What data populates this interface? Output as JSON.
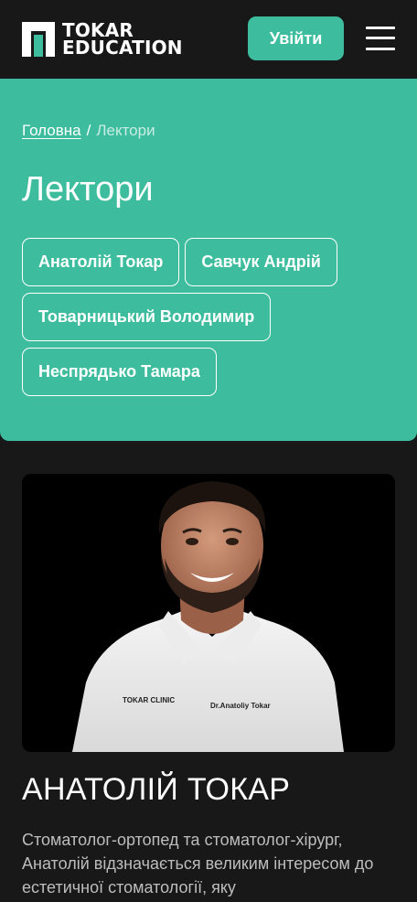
{
  "header": {
    "logo_line1": "TOKAR",
    "logo_line2": "EDUCATION",
    "login_label": "Увійти",
    "menu_icon": "burger-menu-icon"
  },
  "breadcrumb": {
    "home": "Головна",
    "separator": "/",
    "current": "Лектори"
  },
  "page_title": "Лектори",
  "lecturers_filter": [
    "Анатолій Токар",
    "Савчук Андрій",
    "Товарницький Володимир",
    "Неспрядько Тамара"
  ],
  "lecturer": {
    "name": "АНАТОЛІЙ ТОКАР",
    "description": "Стоматолог-ортопед та стоматолог-хірург, Анатолій відзначається великим інтересом до естетичної стоматології, яку",
    "shirt_text_left": "TOKAR CLINIC",
    "shirt_text_right": "Dr.Anatoliy Tokar"
  },
  "colors": {
    "accent": "#3dbd9d",
    "background": "#181818",
    "text": "#ffffff"
  }
}
